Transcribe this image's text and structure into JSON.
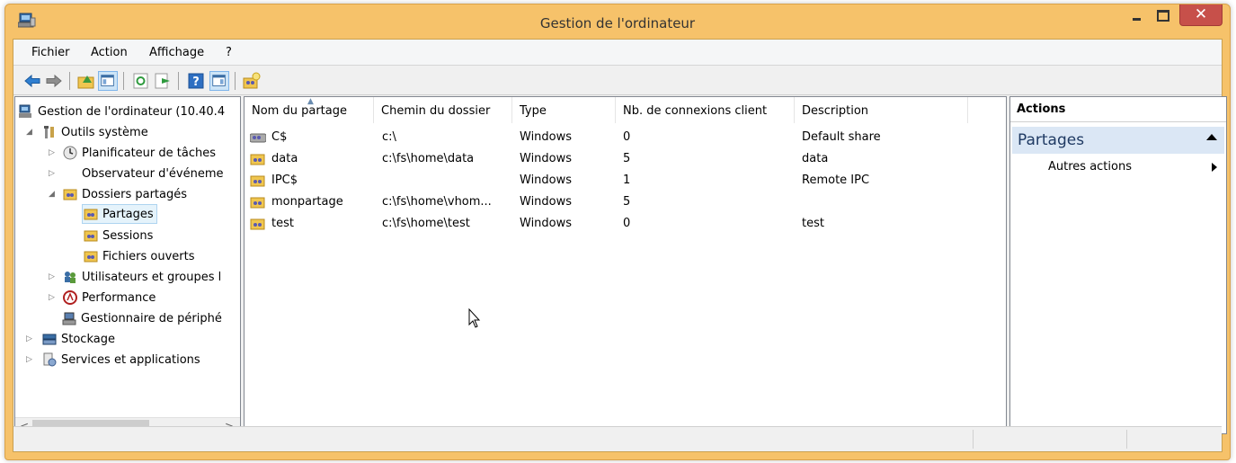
{
  "window": {
    "title": "Gestion de l'ordinateur",
    "close_glyph": "✕",
    "frame_color": "#f6c26a",
    "close_color": "#c7504a"
  },
  "menu": {
    "items": [
      "Fichier",
      "Action",
      "Affichage",
      "?"
    ]
  },
  "toolbar": {
    "buttons": [
      "back-icon",
      "forward-icon",
      "up-folder-icon",
      "show-hide-tree-icon",
      "refresh-icon",
      "export-list-icon",
      "help-icon",
      "show-hide-action-pane-icon",
      "new-share-icon"
    ]
  },
  "tree": {
    "items": [
      {
        "label": "Gestion de l'ordinateur (10.40.4",
        "icon": "computer-management-icon"
      },
      {
        "label": "Outils système",
        "icon": "system-tools-icon",
        "expander": "◢"
      },
      {
        "label": "Planificateur de tâches",
        "icon": "clock-icon",
        "expander": "▷"
      },
      {
        "label": "Observateur d'événeme",
        "icon": "event-viewer-icon",
        "expander": "▷"
      },
      {
        "label": "Dossiers partagés",
        "icon": "shared-folder-icon",
        "expander": "◢"
      },
      {
        "label": "Partages",
        "icon": "shared-folder-icon",
        "selected": true
      },
      {
        "label": "Sessions",
        "icon": "shared-folder-icon"
      },
      {
        "label": "Fichiers ouverts",
        "icon": "shared-folder-icon"
      },
      {
        "label": "Utilisateurs et groupes l",
        "icon": "users-groups-icon",
        "expander": "▷"
      },
      {
        "label": "Performance",
        "icon": "performance-icon",
        "expander": "▷"
      },
      {
        "label": "Gestionnaire de périphé",
        "icon": "device-manager-icon"
      },
      {
        "label": "Stockage",
        "icon": "storage-icon",
        "expander": "▷"
      },
      {
        "label": "Services et applications",
        "icon": "services-icon",
        "expander": "▷"
      }
    ],
    "scroll_left": "<",
    "scroll_right": ">"
  },
  "list": {
    "columns": [
      "Nom du partage",
      "Chemin du dossier",
      "Type",
      "Nb. de connexions client",
      "Description"
    ],
    "rows": [
      {
        "name": "C$",
        "path": "c:\\",
        "type": "Windows",
        "connections": "0",
        "description": "Default share",
        "icon": "admin-share-icon"
      },
      {
        "name": "data",
        "path": "c:\\fs\\home\\data",
        "type": "Windows",
        "connections": "5",
        "description": "data",
        "icon": "shared-folder-icon"
      },
      {
        "name": "IPC$",
        "path": "",
        "type": "Windows",
        "connections": "1",
        "description": "Remote IPC",
        "icon": "shared-folder-icon"
      },
      {
        "name": "monpartage",
        "path": "c:\\fs\\home\\vhom...",
        "type": "Windows",
        "connections": "5",
        "description": "",
        "icon": "shared-folder-icon"
      },
      {
        "name": "test",
        "path": "c:\\fs\\home\\test",
        "type": "Windows",
        "connections": "0",
        "description": "test",
        "icon": "shared-folder-icon"
      }
    ]
  },
  "actions": {
    "title": "Actions",
    "section": "Partages",
    "item": "Autres actions"
  }
}
